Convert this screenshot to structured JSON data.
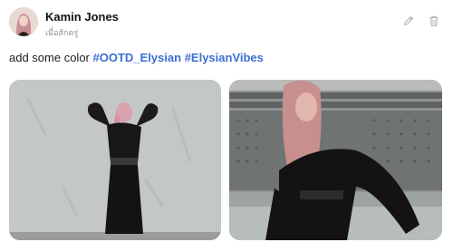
{
  "post": {
    "author": "Kamin Jones",
    "timestamp": "เมื่อสักครู่",
    "caption_text": "add some color",
    "hashtags": [
      "#OOTD_Elysian",
      "#ElysianVibes"
    ]
  },
  "actions": {
    "edit_icon": "pencil-icon",
    "delete_icon": "trash-icon"
  },
  "colors": {
    "hashtag": "#3b6fd4",
    "icon": "#b0b3b8"
  }
}
